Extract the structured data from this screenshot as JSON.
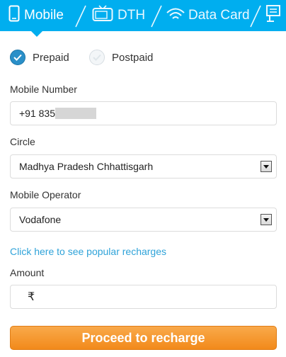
{
  "tabs": [
    {
      "label": "Mobile",
      "icon": "mobile-phone-icon",
      "active": true
    },
    {
      "label": "DTH",
      "icon": "tv-icon",
      "active": false
    },
    {
      "label": "Data Card",
      "icon": "wifi-icon",
      "active": false
    },
    {
      "label": "",
      "icon": "bill-icon",
      "active": false
    }
  ],
  "plan_type": {
    "options": [
      {
        "label": "Prepaid",
        "selected": true
      },
      {
        "label": "Postpaid",
        "selected": false
      }
    ]
  },
  "mobile_number": {
    "label": "Mobile Number",
    "prefix": "+91 83",
    "value_partial": "5"
  },
  "circle": {
    "label": "Circle",
    "value": "Madhya Pradesh Chhattisgarh"
  },
  "operator": {
    "label": "Mobile Operator",
    "value": "Vodafone"
  },
  "popular_link": "Click here to see popular recharges",
  "amount": {
    "label": "Amount",
    "currency_symbol": "₹"
  },
  "cta_label": "Proceed to recharge",
  "colors": {
    "tab_bar": "#00aeef",
    "cta": "#f28a1b",
    "link": "#2fa3d9",
    "radio_selected": "#2a8fc8"
  }
}
